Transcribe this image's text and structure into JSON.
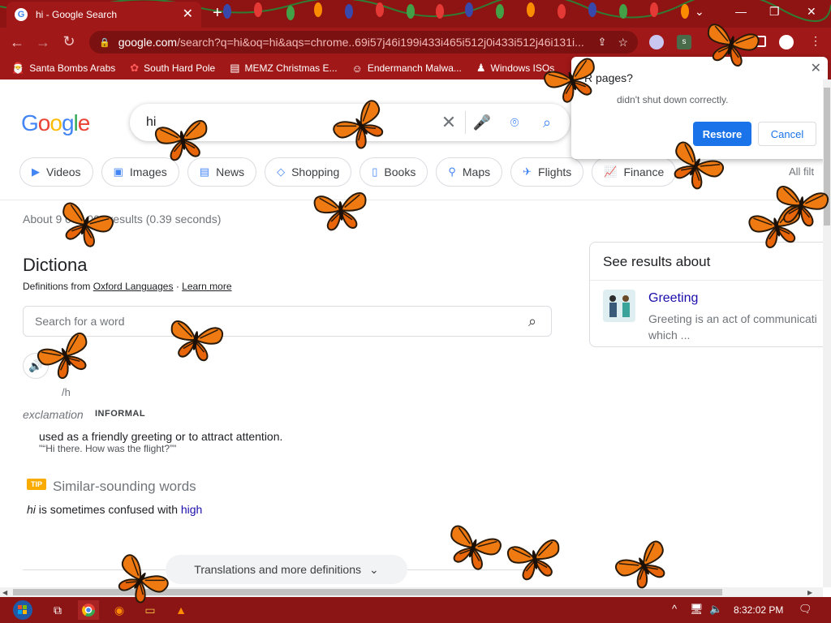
{
  "browser": {
    "tab_title": "hi - Google Search",
    "new_tab": "+",
    "url_host": "google.com",
    "url_rest": "/search?q=hi&oq=hi&aqs=chrome..69i57j46i199i433i465i512j0i433i512j46i131i...",
    "bookmarks": [
      {
        "label": "Santa Bombs Arabs",
        "icon": "santa-icon"
      },
      {
        "label": "South Hard Pole",
        "icon": "flower-icon"
      },
      {
        "label": "MEMZ Christmas E...",
        "icon": "page-icon"
      },
      {
        "label": "Endermanch Malwa...",
        "icon": "face-icon"
      },
      {
        "label": "Windows ISOs",
        "icon": "person-icon"
      }
    ]
  },
  "restore_dialog": {
    "title": "R              pages?",
    "message": "didn't shut down correctly.",
    "restore_label": "Restore",
    "cancel_label": "Cancel"
  },
  "search": {
    "query": "hi",
    "chips": [
      {
        "label": "Videos",
        "icon": "play-icon"
      },
      {
        "label": "Images",
        "icon": "image-icon"
      },
      {
        "label": "News",
        "icon": "news-icon"
      },
      {
        "label": "Shopping",
        "icon": "tag-icon"
      },
      {
        "label": "Books",
        "icon": "book-icon"
      },
      {
        "label": "Maps",
        "icon": "pin-icon"
      },
      {
        "label": "Flights",
        "icon": "plane-icon"
      },
      {
        "label": "Finance",
        "icon": "chart-icon"
      }
    ],
    "all_filters": "All filt",
    "stats": "About 9     000,000 results (0.39 seconds)"
  },
  "dictionary": {
    "title": "Dictiona",
    "source_prefix": "Definitions from",
    "source": "Oxford Languages",
    "learn_more": "Learn more",
    "word_placeholder": "Search for a word",
    "pronunciation": "/h",
    "part_of_speech": "exclamation",
    "register": "INFORMAL",
    "definition": "used as a friendly greeting or to attract attention.",
    "example": "\"“Hi there. How was the flight?”\"",
    "tip_badge": "TIP",
    "similar_title": "Similar-sounding words",
    "confused_word": "hi",
    "confused_text": " is sometimes confused with ",
    "confused_link": "high",
    "translations": "Translations and more definitions"
  },
  "side_panel": {
    "title": "See results about",
    "entity": "Greeting",
    "desc_line1": "Greeting is an act of communicati",
    "desc_line2": "which ..."
  },
  "taskbar": {
    "clock": "8:32:02 PM"
  },
  "colors": {
    "chrome_red": "#a11818",
    "link_blue": "#1a0dab",
    "accent_blue": "#1a73e8"
  }
}
